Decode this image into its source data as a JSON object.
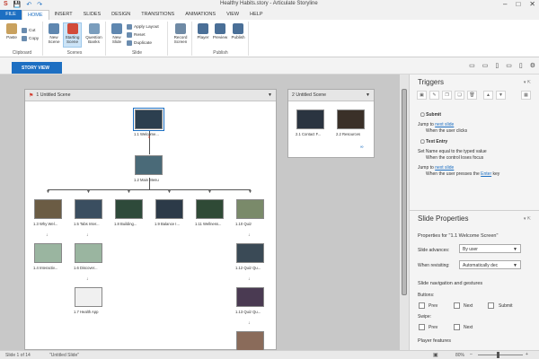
{
  "window": {
    "title": "Healthy Habits.story - Articulate Storyline",
    "app_icon": "storyline-s-icon",
    "controls": [
      "minimize-icon",
      "maximize-icon",
      "close-icon"
    ]
  },
  "ribbon_tabs": [
    "FILE",
    "HOME",
    "INSERT",
    "SLIDES",
    "DESIGN",
    "TRANSITIONS",
    "ANIMATIONS",
    "VIEW",
    "HELP"
  ],
  "ribbon": {
    "clipboard": {
      "paste": "Paste",
      "cut": "Cut",
      "copy": "Copy",
      "label": "Clipboard"
    },
    "scenes": {
      "new_scene": "New Scene",
      "starting_scene": "Starting Scene",
      "question_banks": "Question Banks",
      "label": "Scenes"
    },
    "slide": {
      "new_slide": "New Slide",
      "apply_layout": "Apply Layout",
      "reset": "Reset",
      "duplicate": "Duplicate",
      "label": "Slide"
    },
    "record": {
      "record_screen": "Record Screen"
    },
    "publish": {
      "player": "Player",
      "preview": "Preview",
      "publish": "Publish",
      "label": "Publish"
    }
  },
  "story_view_tab": "STORY VIEW",
  "scene1": {
    "title": "1 Untitled Scene",
    "slides": [
      {
        "label": "1.1 Welcome...",
        "color": "#2c3f4f"
      },
      {
        "label": "1.2 Main Menu",
        "color": "#4a6a78"
      },
      {
        "label": "1.3 Why Wel...",
        "color": "#6b5c44"
      },
      {
        "label": "1.5 Tabs Inter...",
        "color": "#3a4e60"
      },
      {
        "label": "1.8 Building...",
        "color": "#2e4a3a"
      },
      {
        "label": "1.9 Balance I...",
        "color": "#2c3a48"
      },
      {
        "label": "1.11 Wellness...",
        "color": "#2f4a36"
      },
      {
        "label": "1.10 Quiz",
        "color": "#7a8a6a"
      },
      {
        "label": "1.4 Interactiv...",
        "color": "#9ab5a0"
      },
      {
        "label": "1.6 Discover...",
        "color": "#9ab5a0"
      },
      {
        "label": "1.12 Quiz Qu...",
        "color": "#3a4a56"
      },
      {
        "label": "1.7 Health App",
        "color": "#f0f0f0"
      },
      {
        "label": "1.13 Quiz Qu...",
        "color": "#4a3a52"
      },
      {
        "label": "",
        "color": "#8a6b5a"
      }
    ]
  },
  "scene2": {
    "title": "2 Untitled Scene",
    "slides": [
      {
        "label": "2.1 Contact F...",
        "color": "#2a3440"
      },
      {
        "label": "2.2 Resources",
        "color": "#3a3028"
      }
    ]
  },
  "triggers": {
    "title": "Triggers",
    "items": [
      {
        "heading": "Submit",
        "action": "Jump to",
        "link": "next slide",
        "condition": "When the user clicks"
      },
      {
        "heading": "Text Entry",
        "action": "Set Name equal to the typed value",
        "condition": "When the control loses focus"
      },
      {
        "heading": "",
        "action": "Jump to",
        "link": "next slide",
        "condition_pre": "When the user presses the ",
        "condition_link": "Enter",
        "condition_post": " key"
      }
    ]
  },
  "slide_properties": {
    "title": "Slide Properties",
    "properties_for": "Properties for \"1.1 Welcome Screen\"",
    "slide_advances_label": "Slide advances:",
    "slide_advances_value": "By user",
    "when_revisiting_label": "When revisiting:",
    "when_revisiting_value": "Automatically dec",
    "nav_heading": "Slide navigation and gestures",
    "buttons_label": "Buttons:",
    "buttons": [
      "Prev",
      "Next",
      "Submit"
    ],
    "swipe_label": "Swipe:",
    "swipe": [
      "Prev",
      "Next"
    ],
    "player_features": "Player features"
  },
  "status": {
    "slide": "Slide 1 of 14",
    "name": "\"Untitled Slide\"",
    "zoom": "80%"
  }
}
